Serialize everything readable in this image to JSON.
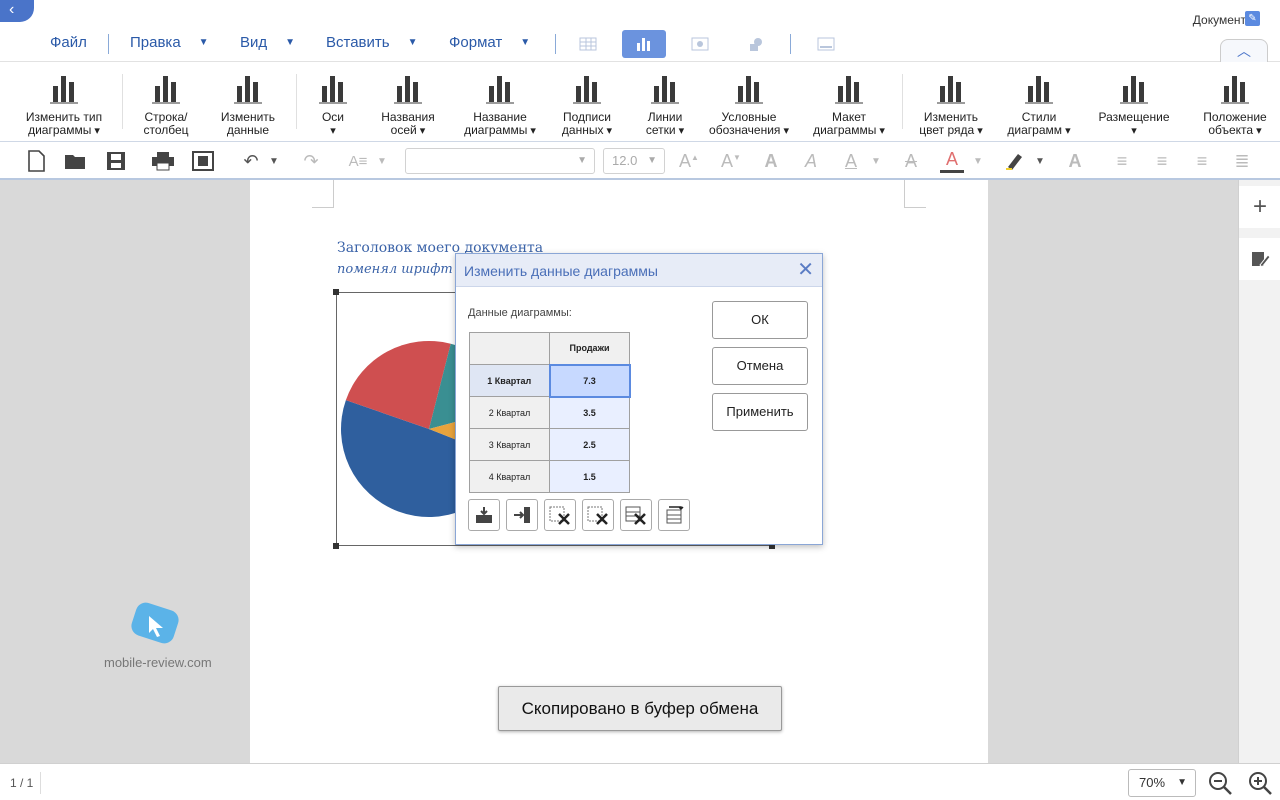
{
  "topbar": {
    "menus": [
      {
        "label": "Файл"
      },
      {
        "label": "Правка"
      },
      {
        "label": "Вид"
      },
      {
        "label": "Вставить"
      },
      {
        "label": "Формат"
      }
    ],
    "document_label": "Документ"
  },
  "ribbon": {
    "items": [
      {
        "line1": "Изменить тип",
        "line2": "диаграммы",
        "icon": "chart-type-icon"
      },
      {
        "line1": "Строка/",
        "line2": "столбец",
        "icon": "row-column-icon"
      },
      {
        "line1": "Изменить",
        "line2": "данные",
        "icon": "edit-data-icon"
      },
      {
        "line1": "Оси",
        "line2": "",
        "icon": "axes-icon"
      },
      {
        "line1": "Названия",
        "line2": "осей",
        "icon": "axis-titles-icon"
      },
      {
        "line1": "Название",
        "line2": "диаграммы",
        "icon": "chart-title-icon"
      },
      {
        "line1": "Подписи",
        "line2": "данных",
        "icon": "data-labels-icon"
      },
      {
        "line1": "Линии",
        "line2": "сетки",
        "icon": "gridlines-icon"
      },
      {
        "line1": "Условные",
        "line2": "обозначения",
        "icon": "legend-icon"
      },
      {
        "line1": "Макет",
        "line2": "диаграммы",
        "icon": "chart-layout-icon"
      },
      {
        "line1": "Изменить",
        "line2": "цвет ряда",
        "icon": "series-color-icon"
      },
      {
        "line1": "Стили",
        "line2": "диаграмм",
        "icon": "chart-styles-icon"
      },
      {
        "line1": "Размещение",
        "line2": "",
        "icon": "wrap-icon"
      },
      {
        "line1": "Положение",
        "line2": "объекта",
        "icon": "object-position-icon"
      }
    ]
  },
  "format_toolbar": {
    "font_name": "",
    "font_size": "12.0"
  },
  "document": {
    "heading": "Заголовок моего документа",
    "subheading": "поменял шрифт"
  },
  "dialog": {
    "title": "Изменить данные диаграммы",
    "data_label": "Данные диаграммы:",
    "column_header": "Продажи",
    "rows": [
      {
        "label": "1 Квартал",
        "value": "7.3"
      },
      {
        "label": "2 Квартал",
        "value": "3.5"
      },
      {
        "label": "3 Квартал",
        "value": "2.5"
      },
      {
        "label": "4 Квартал",
        "value": "1.5"
      }
    ],
    "ok_label": "ОК",
    "cancel_label": "Отмена",
    "apply_label": "Применить"
  },
  "toast": "Скопировано в буфер обмена",
  "watermark": "mobile-review.com",
  "statusbar": {
    "page_count": "1 / 1",
    "zoom": "70%"
  },
  "colors": {
    "accent": "#4a74c9",
    "pie_q1": "#2f5f9e",
    "pie_q2": "#cf4f50",
    "pie_q3": "#3a8f92",
    "pie_q4": "#e8a33c"
  }
}
